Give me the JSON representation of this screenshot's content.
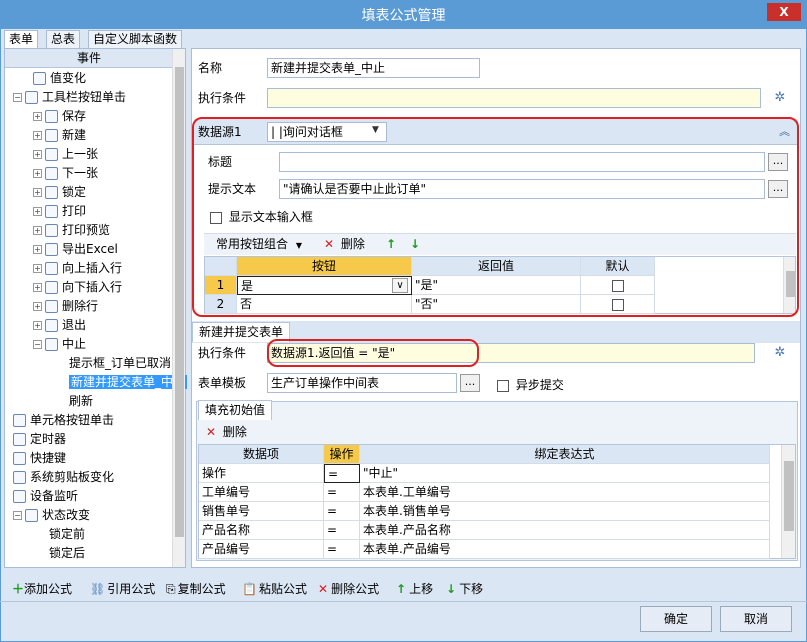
{
  "window": {
    "title": "填表公式管理",
    "close_glyph": "X"
  },
  "tabs": [
    "表单",
    "总表",
    "自定义脚本函数"
  ],
  "tree": {
    "header": "事件",
    "items": [
      {
        "label": "值变化",
        "level": 1,
        "icon": "value-change-icon"
      },
      {
        "label": "工具栏按钮单击",
        "level": 0,
        "icon": "toolbar-click-icon",
        "exp": "−"
      },
      {
        "label": "保存",
        "level": 1,
        "icon": "save-icon",
        "exp": "+"
      },
      {
        "label": "新建",
        "level": 1,
        "icon": "new-icon",
        "exp": "+"
      },
      {
        "label": "上一张",
        "level": 1,
        "icon": "prev-icon",
        "exp": "+"
      },
      {
        "label": "下一张",
        "level": 1,
        "icon": "next-icon",
        "exp": "+"
      },
      {
        "label": "锁定",
        "level": 1,
        "icon": "lock-icon",
        "exp": "+"
      },
      {
        "label": "打印",
        "level": 1,
        "icon": "print-icon",
        "exp": "+"
      },
      {
        "label": "打印预览",
        "level": 1,
        "icon": "print-preview-icon",
        "exp": "+"
      },
      {
        "label": "导出Excel",
        "level": 1,
        "icon": "excel-icon",
        "exp": "+"
      },
      {
        "label": "向上插入行",
        "level": 1,
        "icon": "insert-up-icon",
        "exp": "+"
      },
      {
        "label": "向下插入行",
        "level": 1,
        "icon": "insert-down-icon",
        "exp": "+"
      },
      {
        "label": "删除行",
        "level": 1,
        "icon": "delete-row-icon",
        "exp": "+"
      },
      {
        "label": "退出",
        "level": 1,
        "icon": "exit-icon",
        "exp": "+"
      },
      {
        "label": "中止",
        "level": 1,
        "icon": "abort-icon",
        "exp": "−"
      },
      {
        "label": "提示框_订单已取消",
        "level": 3,
        "icon": ""
      },
      {
        "label": "新建并提交表单_中止",
        "level": 3,
        "icon": "",
        "selected": true
      },
      {
        "label": "刷新",
        "level": 3,
        "icon": ""
      },
      {
        "label": "单元格按钮单击",
        "level": 0,
        "icon": "cell-click-icon"
      },
      {
        "label": "定时器",
        "level": 0,
        "icon": "timer-icon"
      },
      {
        "label": "快捷键",
        "level": 0,
        "icon": "shortcut-icon"
      },
      {
        "label": "系统剪贴板变化",
        "level": 0,
        "icon": "clipboard-icon"
      },
      {
        "label": "设备监听",
        "level": 0,
        "icon": "device-icon"
      },
      {
        "label": "状态改变",
        "level": 0,
        "icon": "state-icon",
        "exp": "−"
      },
      {
        "label": "锁定前",
        "level": 2,
        "icon": ""
      },
      {
        "label": "锁定后",
        "level": 2,
        "icon": ""
      }
    ]
  },
  "form": {
    "name_label": "名称",
    "name_value": "新建并提交表单_中止",
    "condition_label": "执行条件",
    "condition_value": ""
  },
  "datasource": {
    "label": "数据源1",
    "select_value": "| |询问对话框",
    "title_label": "标题",
    "title_value": "",
    "prompt_label": "提示文本",
    "prompt_value": "\"请确认是否要中止此订单\"",
    "show_input_label": "显示文本输入框",
    "button_combo_label": "常用按钮组合",
    "delete_label": "删除",
    "grid_headers": [
      "按钮",
      "返回值",
      "默认"
    ],
    "grid_rows": [
      {
        "n": "1",
        "button": "是",
        "ret": "\"是\""
      },
      {
        "n": "2",
        "button": "否",
        "ret": "\"否\""
      }
    ]
  },
  "submit": {
    "tab_label": "新建并提交表单",
    "condition_label": "执行条件",
    "condition_value": "数据源1.返回值 = \"是\"",
    "template_label": "表单模板",
    "template_value": "生产订单操作中间表",
    "async_label": "异步提交",
    "fill_tab": "填充初始值",
    "delete_label": "删除",
    "grid_headers": [
      "数据项",
      "操作",
      "绑定表达式"
    ],
    "grid_rows": [
      {
        "item": "操作",
        "op": "=",
        "expr": "\"中止\""
      },
      {
        "item": "工单编号",
        "op": "=",
        "expr": "本表单.工单编号"
      },
      {
        "item": "销售单号",
        "op": "=",
        "expr": "本表单.销售单号"
      },
      {
        "item": "产品名称",
        "op": "=",
        "expr": "本表单.产品名称"
      },
      {
        "item": "产品编号",
        "op": "=",
        "expr": "本表单.产品编号"
      }
    ]
  },
  "bottom": {
    "add": "添加公式",
    "ref": "引用公式",
    "copy": "复制公式",
    "paste": "粘贴公式",
    "del": "删除公式",
    "up": "上移",
    "down": "下移",
    "ok": "确定",
    "cancel": "取消"
  },
  "colors": {
    "accent": "#5b9bd5",
    "highlight": "#f6c94a",
    "annotation": "#e02020"
  }
}
